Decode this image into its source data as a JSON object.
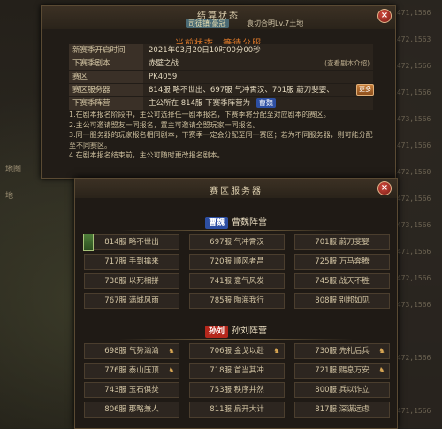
{
  "background": {
    "left_labels": [
      "地图",
      "地"
    ],
    "right_rows": [
      "1471,1566",
      "1472,1563",
      "1472,1566",
      "1471,1566",
      "1473,1566",
      "1471,1566",
      "1472,1560",
      "1472,1566",
      "1473,1566",
      "1471,1566",
      "1472,1566",
      "1473,1566",
      "1472,1566",
      "1471,1566"
    ]
  },
  "top_panel": {
    "title": "结算状态",
    "tag": "司徒镇·豪冠",
    "sub": "袁切合明Lv.7土地",
    "close_label": "×",
    "status_label": "当前状态",
    "status_value": "等待分服",
    "rows": [
      {
        "label": "新赛季开启时间",
        "value": "2021年03月20日10时00分00秒"
      },
      {
        "label": "下赛季剧本",
        "value": "赤壁之战",
        "link": "(查看剧本介绍)"
      },
      {
        "label": "赛区",
        "value": "PK4059"
      },
      {
        "label": "赛区服务器",
        "value": "814服 略不世出、697服 气冲霄汉、701服 蔚刀斐婴、",
        "button": "更多"
      },
      {
        "label": "下赛季阵营",
        "value": "主公所在 814服 下赛季阵营为",
        "chip": "曹魏"
      }
    ],
    "rules": [
      "1.在剧本报名阶段中，主公可选择任一剧本报名，下赛季将分配至对应剧本的赛区。",
      "2.主公可邀请盟友一同报名，置主可邀请全盟玩家一同报名。",
      "3.同一服务器的玩家报名相同剧本，下赛季一定会分配至同一赛区；若为不同服务器，则可能分配至不同赛区。",
      "4.在剧本报名结束前，主公可随时更改报名剧本。"
    ]
  },
  "bottom_panel": {
    "title": "赛区服务器",
    "close_label": "×",
    "camp1": {
      "badge": "曹魏",
      "name": "曹魏阵营",
      "color": "#2d4fa3",
      "servers": [
        "814服 略不世出",
        "697服 气冲霄汉",
        "701服 蔚刀斐婴",
        "717服 手到擒来",
        "720服 顺风者昌",
        "725服 万马奔腾",
        "738服 以死相拼",
        "741服 意气风发",
        "745服 战天不胜",
        "767服 满城风雨",
        "785服 陶海我行",
        "808服 别邦如见"
      ]
    },
    "camp2": {
      "badge": "孙刘",
      "name": "孙刘阵营",
      "color": "#b5281c",
      "servers": [
        "698服 气势汹汹",
        "706服 金戈以赴",
        "730服 先礼后兵",
        "776服 泰山压顶",
        "718服 首当其冲",
        "721服 赐息万安",
        "743服 玉石俱焚",
        "753服 秩序井然",
        "800服 兵以诈立",
        "806服 那略兼人",
        "811服 扁开大计",
        "817服 深谋远虑"
      ]
    }
  }
}
